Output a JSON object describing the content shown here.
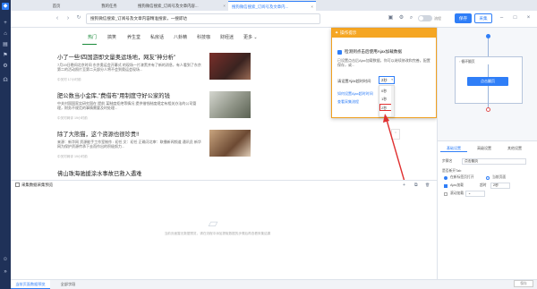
{
  "rail": {
    "items": [
      {
        "icon": "app-logo-icon",
        "glyph": "◆"
      },
      {
        "icon": "add-icon",
        "glyph": "+"
      },
      {
        "icon": "home-icon",
        "glyph": "⌂"
      },
      {
        "icon": "tasks-icon",
        "glyph": "▤"
      },
      {
        "icon": "data-icon",
        "glyph": "⚑"
      },
      {
        "icon": "tools-icon",
        "glyph": "⚙"
      },
      {
        "icon": "headset-icon",
        "glyph": "☊"
      },
      {
        "icon": "user-icon",
        "glyph": "☺"
      },
      {
        "icon": "collapse-icon",
        "glyph": "»"
      }
    ]
  },
  "tabs": [
    {
      "label": "首页"
    },
    {
      "label": "我的任务"
    },
    {
      "label": "搜狗微信搜索_订阅号及文章内容..."
    },
    {
      "label": "搜狗微信搜索_订阅号及文章内..."
    }
  ],
  "address": {
    "url": "搜狗微信搜索_订阅号及文章内容精准搜索，一搜即达",
    "toggle_label": "流程",
    "save_label": "保存",
    "collect_label": "采集",
    "back_glyph": "‹",
    "forward_glyph": "›",
    "refresh_glyph": "↻",
    "search_glyph": "⌕"
  },
  "site_nav": {
    "items": [
      "热门",
      "搞笑",
      "养生堂",
      "私房话",
      "八卦精",
      "科技咖",
      "财经迷",
      "更多 ⌄"
    ]
  },
  "articles": [
    {
      "title": "小了一些!四国游即文量奥运场地，网友\"神分析\"",
      "desc": "7月19日晚间北京时间 东京奥运会开幕式 的现场一片漆黑并有了新的消息，有人看到了东京第二的活动照片至第二天部分人将不会到奥运会现场...",
      "meta": "中关村  17小时前"
    },
    {
      "title": "肥公数当小金库,\"费借布\"用制度守好公家的钱",
      "desc": "中关村国国家实研究国在 提前 某制度拒绝等情况 提供借钱制度规定有相关办法的公司管理，财务不规范的事情需要及时处理...",
      "meta": "中关村网评  19小时前"
    },
    {
      "title": "除了大熊猫，这个资源也很珍贵!!",
      "desc": "来源：新华网 资源能手工作室制作 : 初任 文：初任 正确河北审：联播新闻频道 通讯员 新华网为保护资源传承下去而作出的积极努力...",
      "meta": "中关村网评  19小时前"
    },
    {
      "title": "佛山珠海驰援涂水事故已救入遇难",
      "desc": "",
      "meta": ""
    }
  ],
  "popup": {
    "title": "操作提示",
    "check_label": "检测到点击后使用Ajax加载数据",
    "desc": "已设置点击后Ajax加载数据，你可以继续修改和完善。配置保存，或...",
    "timeout_label": "请设置Ajax超时时间",
    "timeout_value": "2秒",
    "options": [
      "0秒",
      "1秒",
      "2秒"
    ],
    "link1": "如何设置Ajax超时时间",
    "link2": "查看采集流程"
  },
  "bottom": {
    "title": "采集数据采集预览",
    "empty_text": "当前页面暂无数据预览，请在流程中添加提取数据的步骤后再查看采集结果",
    "add_glyph": "+",
    "copy_glyph": "⧉",
    "delete_glyph": "🗑"
  },
  "footer": {
    "tabs": [
      "当前页面数据预览",
      "全部字段"
    ]
  },
  "flow": {
    "loop_label": "◦ 循环翻页",
    "action_label": "点击翻页"
  },
  "props": {
    "tabs": [
      "基础设置",
      "高级设置",
      "其他设置"
    ],
    "name_label": "步骤名",
    "name_value": "点击翻页",
    "open_new_tab_label": "是否新开Tab",
    "radio1_label": "在新标签页打开",
    "radio2_label": "当前页面",
    "ajax_label": "Ajax加载",
    "timeout_label": "超时",
    "timeout_value": "2秒",
    "scroll_label": "滚动加载",
    "save_label": "保存"
  },
  "colors": {
    "accent": "#2f7ef7",
    "popup_orange": "#f5a623",
    "annotation_red": "#e03030",
    "rail": "#1f3158"
  }
}
